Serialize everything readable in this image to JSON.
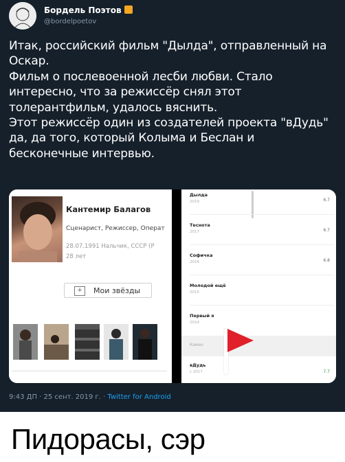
{
  "tweet": {
    "author": "Бордель Поэтов",
    "handle": "@bordelpoetov",
    "text_lines": [
      "Итак, российский фильм \"Дылда\", отправленный на Оскар.",
      "Фильм о послевоенной лесби любви. Стало интересно, что за режиссёр снял этот толерантфильм, удалось вяснить.",
      "Этот режиссёр один из создателей проекта \"вДудь\" да, да того, который Колыма и Беслан и бесконечные интервью."
    ],
    "time": "9:43 ДП",
    "date": "25 сент. 2019 г.",
    "source": "Twitter for Android"
  },
  "profile": {
    "name": "Кантемир Балагов",
    "roles": "Сценарист, Режиссер, Операт",
    "birth": "28.07.1991 Нальчик, СССР (Р",
    "age": "28 лет",
    "stars_button": "Мои звёзды",
    "plus_icon": "+"
  },
  "films": [
    {
      "title": "Дылда",
      "year": "2019",
      "rating": "6.7"
    },
    {
      "title": "Теснота",
      "year": "2017",
      "rating": "6.7"
    },
    {
      "title": "Софичка",
      "year": "2016",
      "rating": "6.8"
    },
    {
      "title": "Молодой ещё",
      "year": "2015",
      "rating": ""
    },
    {
      "title": "Первый я",
      "year": "2014",
      "rating": ""
    },
    {
      "title": "вДудь",
      "year": "с 2017",
      "rating": "7.7"
    }
  ],
  "cameo_label": "Камео",
  "caption": "Пидорасы, сэр",
  "colors": {
    "tweet_bg": "#15202b",
    "link": "#1da1f2",
    "flag": "#e0202a",
    "badge": "#f5a623"
  }
}
